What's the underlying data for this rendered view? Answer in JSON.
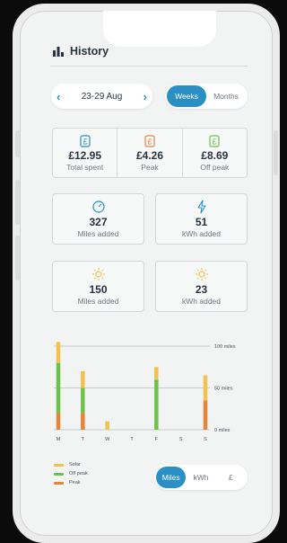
{
  "header": {
    "title": "History",
    "icon": "bar-chart-icon"
  },
  "date_nav": {
    "range": "23-29 Aug",
    "prev": "‹",
    "next": "›"
  },
  "period_toggle": {
    "options": [
      "Weeks",
      "Months"
    ],
    "selected": "Weeks"
  },
  "costs": [
    {
      "icon": "pound-icon",
      "color": "#2a8fc4",
      "value": "£12.95",
      "label": "Total spent"
    },
    {
      "icon": "pound-icon",
      "color": "#e8833a",
      "value": "£4.26",
      "label": "Peak"
    },
    {
      "icon": "pound-icon",
      "color": "#6cc24a",
      "value": "£8.69",
      "label": "Off peak"
    }
  ],
  "stats": [
    {
      "icon": "gauge-icon",
      "value": "327",
      "label": "Miles added"
    },
    {
      "icon": "lightning-icon",
      "value": "51",
      "label": "kWh added"
    },
    {
      "icon": "sun-icon",
      "value": "150",
      "label": "Miles added"
    },
    {
      "icon": "sun-icon",
      "value": "23",
      "label": "kWh added"
    }
  ],
  "chart_data": {
    "type": "bar",
    "stacked": true,
    "categories": [
      "M",
      "T",
      "W",
      "T",
      "F",
      "S",
      "S"
    ],
    "series": [
      {
        "name": "Peak",
        "color": "#e8833a",
        "values": [
          20,
          20,
          0,
          0,
          0,
          0,
          35
        ]
      },
      {
        "name": "Off peak",
        "color": "#6cc24a",
        "values": [
          60,
          30,
          0,
          0,
          60,
          0,
          0
        ]
      },
      {
        "name": "Solar",
        "color": "#f2c14e",
        "values": [
          25,
          20,
          10,
          0,
          15,
          0,
          30
        ]
      }
    ],
    "yticks": [
      "0 miles",
      "50 miles",
      "100 miles"
    ],
    "ylim": [
      0,
      100
    ],
    "grid": true
  },
  "legend": [
    "Solar",
    "Off peak",
    "Peak"
  ],
  "unit_toggle": {
    "options": [
      "Miles",
      "kWh",
      "£"
    ],
    "selected": "Miles"
  },
  "colors": {
    "accent": "#2a8fc4",
    "solar": "#f2c14e",
    "offpeak": "#6cc24a",
    "peak": "#e8833a"
  }
}
